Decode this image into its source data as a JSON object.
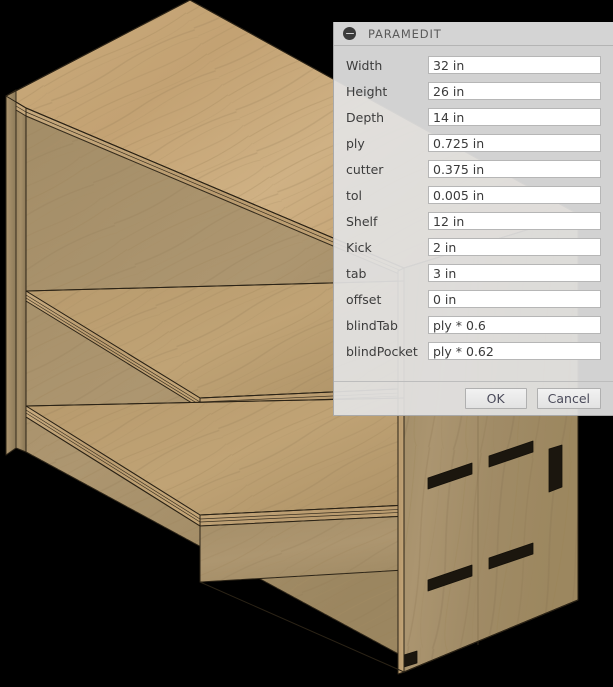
{
  "dialog": {
    "title": "PARAMEDIT",
    "collapse_icon": "collapse-circle-icon",
    "parameters": [
      {
        "label": "Width",
        "value": "32 in"
      },
      {
        "label": "Height",
        "value": "26 in"
      },
      {
        "label": "Depth",
        "value": "14 in"
      },
      {
        "label": "ply",
        "value": "0.725 in"
      },
      {
        "label": "cutter",
        "value": "0.375 in"
      },
      {
        "label": "tol",
        "value": "0.005 in"
      },
      {
        "label": "Shelf",
        "value": "12 in"
      },
      {
        "label": "Kick",
        "value": "2 in"
      },
      {
        "label": "tab",
        "value": "3 in"
      },
      {
        "label": "offset",
        "value": "0 in"
      },
      {
        "label": "blindTab",
        "value": "ply * 0.6"
      },
      {
        "label": "blindPocket",
        "value": "ply * 0.62"
      }
    ],
    "buttons": {
      "ok": "OK",
      "cancel": "Cancel"
    }
  },
  "viewport": {
    "model_name": "plywood-bookshelf-isometric",
    "background_color": "#000000",
    "wood_light": "#cbac7c",
    "wood_mid": "#b79a6d",
    "wood_dark": "#94805c",
    "wood_shadow": "#7e6d4e",
    "edge_color": "#2b2316"
  }
}
